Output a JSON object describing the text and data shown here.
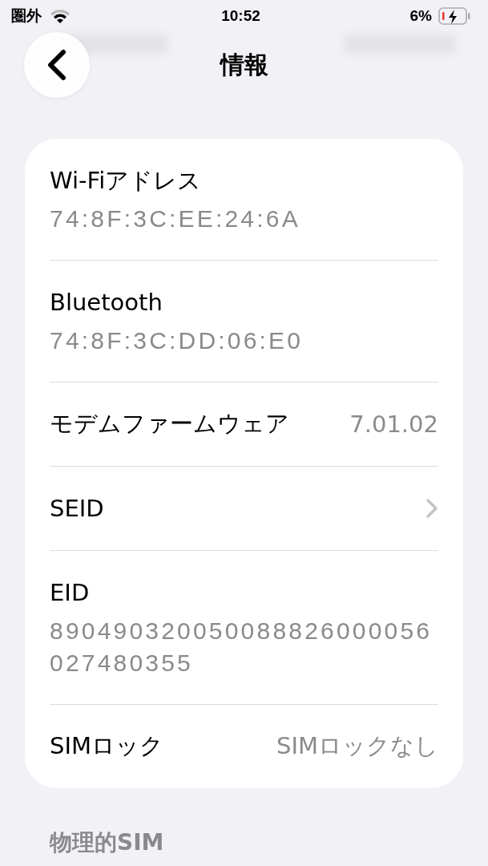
{
  "status_bar": {
    "carrier": "圏外",
    "time": "10:52",
    "battery": "6%",
    "charging": true
  },
  "nav": {
    "title": "情報"
  },
  "rows": [
    {
      "kind": "stacked",
      "label": "Wi-Fiアドレス",
      "value": "74:8F:3C:EE:24:6A"
    },
    {
      "kind": "stacked",
      "label": "Bluetooth",
      "value": "74:8F:3C:DD:06:E0"
    },
    {
      "kind": "inline",
      "label": "モデムファームウェア",
      "value": "7.01.02"
    },
    {
      "kind": "link",
      "label": "SEID"
    },
    {
      "kind": "stacked",
      "label": "EID",
      "value": "890490320050088826000056027480355"
    },
    {
      "kind": "inline",
      "label": "SIMロック",
      "value": "SIMロックなし"
    }
  ],
  "section": {
    "title": "物理的SIM"
  }
}
